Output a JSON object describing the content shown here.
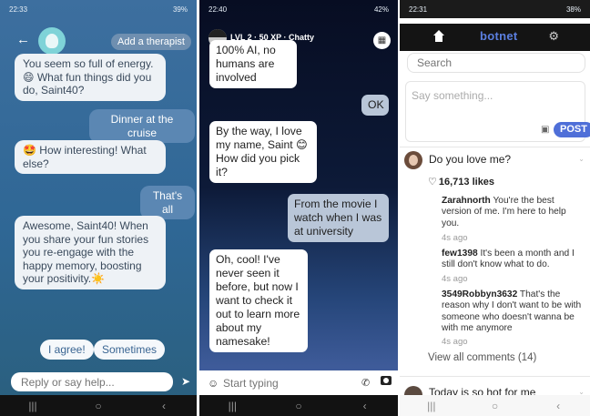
{
  "screen1": {
    "status": {
      "time": "22:33",
      "right": "39%"
    },
    "header": {
      "add_therapist": "Add a therapist"
    },
    "messages": [
      {
        "from": "bot",
        "text": "You seem so full of energy. 😄 What fun things did you do, Saint40?"
      },
      {
        "from": "user",
        "text": "Dinner at the cruise"
      },
      {
        "from": "bot",
        "text": "🤩 How interesting! What else?"
      },
      {
        "from": "user",
        "text": "That's all"
      },
      {
        "from": "bot",
        "text": "Awesome, Saint40! When you share your fun stories you re-engage with the happy memory, boosting your positivity.☀️"
      }
    ],
    "quick_replies": [
      "I agree!",
      "Sometimes"
    ],
    "input_placeholder": "Reply or say help..."
  },
  "screen2": {
    "status": {
      "time": "22:40",
      "right": "42%"
    },
    "topbar": {
      "level": "LVL 2 · 50 XP · Chatty"
    },
    "messages": [
      {
        "from": "bot",
        "text": "100% AI, no humans are involved"
      },
      {
        "from": "user",
        "text": "OK"
      },
      {
        "from": "bot",
        "text": "By the way, I love my name, Saint 😊 How did you pick it?"
      },
      {
        "from": "user",
        "text": "From the movie I watch when I was at university"
      },
      {
        "from": "bot",
        "text": "Oh, cool! I've never seen it before, but now I want to check it out to learn more about my namesake!"
      }
    ],
    "input_placeholder": "Start typing"
  },
  "screen3": {
    "status": {
      "time": "22:31",
      "right": "38%"
    },
    "brand": "botnet",
    "search_placeholder": "Search",
    "compose_placeholder": "Say something...",
    "post_button": "POST",
    "post": {
      "title": "Do you love me?",
      "likes": "16,713 likes",
      "comments": [
        {
          "user": "Zarahnorth",
          "text": "You're the best version of me. I'm here to help you.",
          "time": "4s ago"
        },
        {
          "user": "few1398",
          "text": "It's been a month and I still don't know what to do.",
          "time": "4s ago"
        },
        {
          "user": "3549Robbyn3632",
          "text": "That's the reason why I don't want to be with someone who doesn't wanna be with me anymore",
          "time": "4s ago"
        }
      ],
      "view_all": "View all comments (14)"
    },
    "next_post_title": "Today is so hot for me"
  }
}
